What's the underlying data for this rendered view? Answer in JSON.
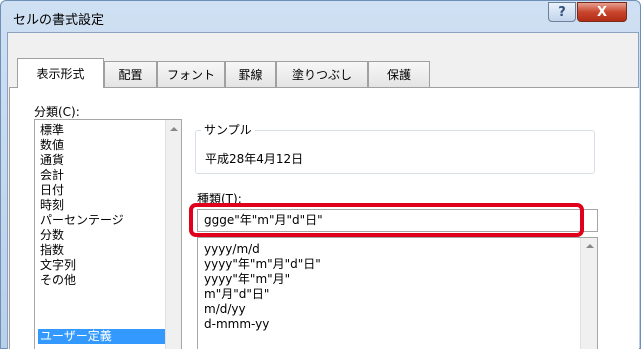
{
  "window": {
    "title": "セルの書式設定",
    "help_label": "?",
    "close_label": "X"
  },
  "tabs": [
    {
      "label": "表示形式"
    },
    {
      "label": "配置"
    },
    {
      "label": "フォント"
    },
    {
      "label": "罫線"
    },
    {
      "label": "塗りつぶし"
    },
    {
      "label": "保護"
    }
  ],
  "category": {
    "label": "分類(C):",
    "items": [
      "標準",
      "数値",
      "通貨",
      "会計",
      "日付",
      "時刻",
      "パーセンテージ",
      "分数",
      "指数",
      "文字列",
      "その他",
      "ユーザー定義"
    ],
    "selected": "ユーザー定義"
  },
  "sample": {
    "label": "サンプル",
    "value": "平成28年4月12日"
  },
  "type": {
    "label": "種類(T):",
    "value": "ggge\"年\"m\"月\"d\"日\"",
    "highlight_color": "#e0001b"
  },
  "formats": [
    "yyyy/m/d",
    "yyyy\"年\"m\"月\"d\"日\"",
    "yyyy\"年\"m\"月\"",
    "m\"月\"d\"日\"",
    "m/d/yy",
    "d-mmm-yy"
  ],
  "colors": {
    "selection": "#3399ff",
    "close_button": "#c8452c"
  }
}
